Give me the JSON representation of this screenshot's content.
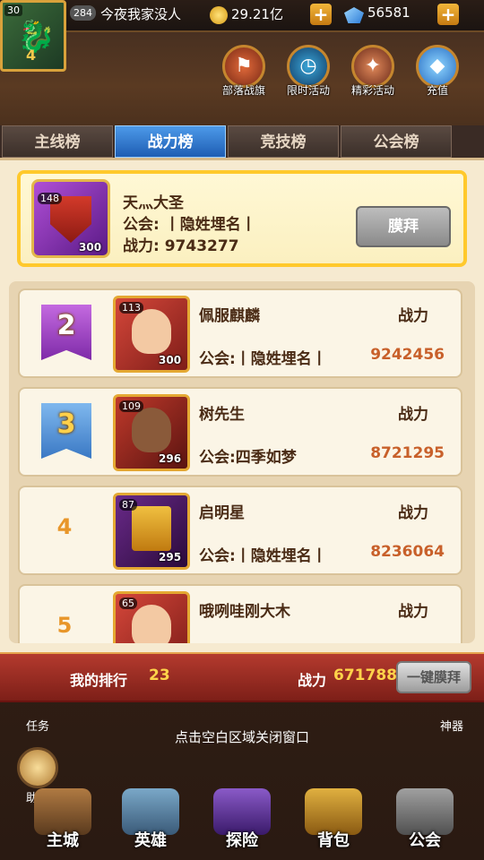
{
  "topbar": {
    "level": "30",
    "vip": "4",
    "badge": "284",
    "player_name": "今夜我家没人",
    "gold": "29.21亿",
    "gems": "56581",
    "plus": "+"
  },
  "activities": [
    {
      "label": "部落战旗"
    },
    {
      "label": "限时活动"
    },
    {
      "label": "精彩活动"
    },
    {
      "label": "充值"
    }
  ],
  "tabs": [
    {
      "label": "主线榜",
      "active": false
    },
    {
      "label": "战力榜",
      "active": true
    },
    {
      "label": "竞技榜",
      "active": false
    },
    {
      "label": "公会榜",
      "active": false
    }
  ],
  "first_place": {
    "level": "148",
    "power_badge": "300",
    "name": "天灬大圣",
    "guild": "公会: 丨隐姓埋名丨",
    "power": "战力: 9743277",
    "worship_label": "膜拜"
  },
  "ranking": [
    {
      "rank": "2",
      "level": "113",
      "power_badge": "300",
      "name": "佩服麒麟",
      "power_label": "战力",
      "guild": "公会:丨隐姓埋名丨",
      "power": "9242456"
    },
    {
      "rank": "3",
      "level": "109",
      "power_badge": "296",
      "name": "树先生",
      "power_label": "战力",
      "guild": "公会:四季如梦",
      "power": "8721295"
    },
    {
      "rank": "4",
      "level": "87",
      "power_badge": "295",
      "name": "启明星",
      "power_label": "战力",
      "guild": "公会:丨隐姓埋名丨",
      "power": "8236064"
    },
    {
      "rank": "5",
      "level": "65",
      "power_badge": "",
      "name": "哦咧哇刚大木",
      "power_label": "战力",
      "guild": "",
      "power": ""
    }
  ],
  "my_rank": {
    "label": "我的排行",
    "rank": "23",
    "power_label": "战力",
    "power": "6717881",
    "worship_all_label": "一键膜拜"
  },
  "hint": "点击空白区域关闭窗口",
  "side": {
    "task": "任务",
    "helper": "助手",
    "artifact": "神器"
  },
  "nav": [
    {
      "label": "主城"
    },
    {
      "label": "英雄"
    },
    {
      "label": "探险"
    },
    {
      "label": "背包"
    },
    {
      "label": "公会"
    }
  ],
  "colors": {
    "tab_active": "#1e5db3",
    "first_border": "#ffc92c",
    "power_value": "#c8602a",
    "my_bar": "#b43a2e"
  }
}
